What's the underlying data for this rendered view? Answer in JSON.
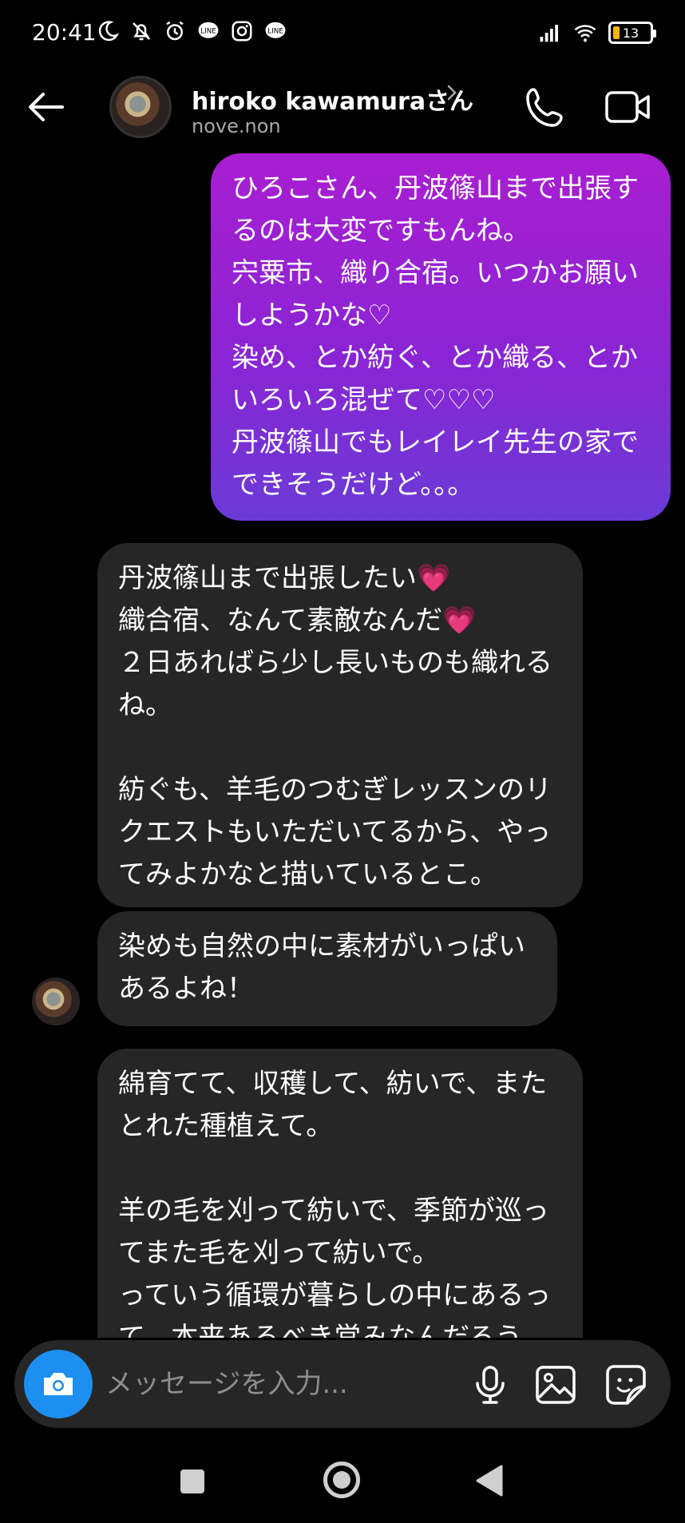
{
  "status_bar": {
    "time": "20:41",
    "battery": "13",
    "left_icons": [
      "moon-icon",
      "notifications-off-icon",
      "alarm-icon",
      "line-icon",
      "instagram-icon",
      "line-icon"
    ],
    "right_icons": [
      "signal-icon",
      "wifi-icon",
      "battery-icon"
    ]
  },
  "header": {
    "contact_name": "hiroko kawamuraさん",
    "handle": "nove.non"
  },
  "messages": {
    "sent_1": "ひろこさん、丹波篠山まで出張するのは大変ですもんね。\n宍粟市、織り合宿。いつかお願いしようかな♡\n染め、とか紡ぐ、とか織る、とかいろいろ混ぜて♡♡♡\n丹波篠山でもレイレイ先生の家でできそうだけど。。。",
    "recv_1_line1": "丹波篠山まで出張したい",
    "recv_1_line2": "織合宿、なんて素敵なんだ",
    "recv_1_rest": "２日あればら少し長いものも織れるね。\n\n紡ぐも、羊毛のつむぎレッスンのリクエストもいただいてるから、やってみよかなと描いているとこ。",
    "recv_2": "染めも自然の中に素材がいっぱいあるよね！",
    "recv_3": "綿育てて、収穫して、紡いで、またとれた種植えて。\n\n羊の毛を刈って紡いで、季節が巡ってまた毛を刈って紡いで。\nっていう循環が暮らしの中にあるって、本来あるべき営みなんだろう"
  },
  "composer": {
    "placeholder": "メッセージを入力..."
  },
  "colors": {
    "sent_gradient_top": "#a91ed1",
    "sent_gradient_bottom": "#6a3bd6",
    "received_bubble": "#262626",
    "camera_button": "#1c8ff0",
    "heart": "#ff3b8b"
  }
}
